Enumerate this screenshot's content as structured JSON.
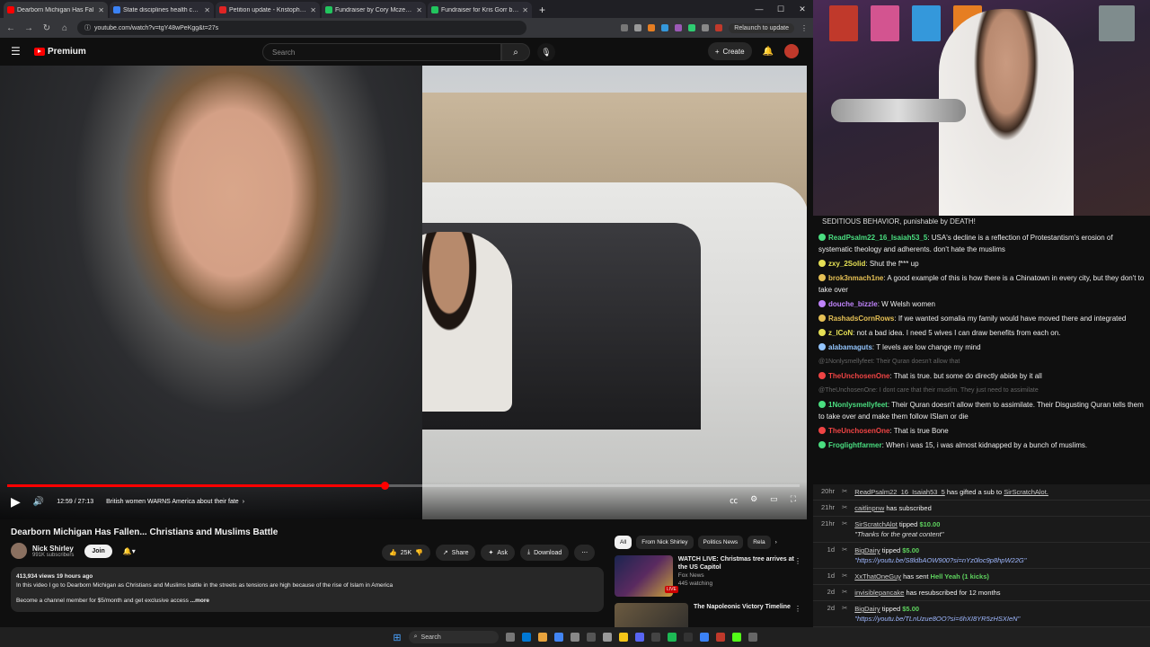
{
  "browser": {
    "tabs": [
      {
        "title": "Dearborn Michigan Has Fal",
        "color": "#ff0000",
        "active": true
      },
      {
        "title": "State disciplines health care pro",
        "color": "#3b82f6"
      },
      {
        "title": "Petition update - Kristopher's st",
        "color": "#e02424"
      },
      {
        "title": "Fundraiser by Cory Mczenna",
        "color": "#22c55e"
      },
      {
        "title": "Fundraiser for Kris Gorr by Kell",
        "color": "#22c55e"
      }
    ],
    "newtab": "+",
    "url": "youtube.com/watch?v=tgY48wPeKgg&t=27s",
    "relaunch": "Relaunch to update"
  },
  "yt": {
    "brand": "Premium",
    "search_placeholder": "Search",
    "create": "Create"
  },
  "video": {
    "time": "12:59 / 27:13",
    "chapter": "British women WARNS America about their fate",
    "progress": 0.476,
    "title": "Dearborn Michigan Has Fallen... Christians and Muslims Battle",
    "channel": "Nick Shirley",
    "subs": "991K subscribers",
    "join": "Join",
    "likes": "25K",
    "share": "Share",
    "ask": "Ask",
    "download": "Download",
    "desc_line1": "413,934 views  19 hours ago",
    "desc_line2": "In this video I go to Dearborn Michigan as Christians and Muslims battle in the streets as tensions are high because of the rise of Islam in America",
    "desc_line3": "Become a channel member for $5/month and get exclusive access",
    "more": "...more"
  },
  "recs": {
    "chips": [
      "All",
      "From Nick Shirley",
      "Politics News",
      "Rela"
    ],
    "items": [
      {
        "title": "WATCH LIVE: Christmas tree arrives at the US Capitol",
        "channel": "Fox News",
        "meta": "445 watching",
        "live": "LIVE"
      },
      {
        "title": "The Napoleonic Victory Timeline",
        "channel": "",
        "meta": ""
      }
    ]
  },
  "chat": {
    "top": "SEDITIOUS BEHAVIOR, punishable by DEATH!",
    "messages": [
      {
        "user": "ReadPsalm22_16_Isaiah53_5",
        "color": "#4ade80",
        "text": "USA's decline is a reflection of Protestantism's erosion of systematic theology and adherents. don't hate the muslims"
      },
      {
        "user": "zxy_2Solid",
        "color": "#e5e055",
        "text": "Shut the f*** up"
      },
      {
        "user": "brok3nmach1ne",
        "color": "#e5c055",
        "text": "A good example of this is how there is a Chinatown in every city, but they don't to take over"
      },
      {
        "user": "douche_bizzle",
        "color": "#c084fc",
        "text": "W Welsh women"
      },
      {
        "user": "RashadsCornRows",
        "color": "#e5c055",
        "text": "If we wanted somalia my family would have moved there and integrated"
      },
      {
        "user": "z_lCoN",
        "color": "#e5e055",
        "text": "not a bad idea. I need 5 wives I can draw benefits from each on."
      },
      {
        "user": "alabamaguts",
        "color": "#93c5fd",
        "text": "T levels are low change my mind"
      },
      {
        "reply": "@1Nonlysmellyfeet: Their Quran doesn't allow that"
      },
      {
        "user": "TheUnchosenOne",
        "color": "#ef4444",
        "text": "That is true. but some do directly abide by it all"
      },
      {
        "reply": "@TheUnchosenOne: I dont care that their muslim. They just need to assimilate"
      },
      {
        "user": "1Nonlysmellyfeet",
        "color": "#4ade80",
        "text": "Their Quran doesn't allow them to assimilate. Their Disgusting Quran tells them to take over and make them follow ISlam or die"
      },
      {
        "user": "TheUnchosenOne",
        "color": "#ef4444",
        "text": "That is true Bone"
      },
      {
        "user": "Froglightfarmer",
        "color": "#4ade80",
        "text": "When i was 15, i was almost kidnapped by a bunch of muslims."
      }
    ]
  },
  "events": [
    {
      "t": "20hr",
      "name": "ReadPsalm22_16_Isaiah53_5",
      "action": "has gifted a sub to",
      "target": "SirScratchAlot."
    },
    {
      "t": "21hr",
      "name": "caitlinpnw",
      "action": "has subscribed"
    },
    {
      "t": "21hr",
      "name": "SirScratchAlot",
      "action": "tipped",
      "amount": "$10.00",
      "quote": "\"Thanks for the great content\""
    },
    {
      "t": "1d",
      "name": "BigDairy",
      "action": "tipped",
      "amount": "$5.00",
      "link": "\"https://youtu.be/S8ldbAOW900?si=nYz0loc9p8hpW22G\""
    },
    {
      "t": "1d",
      "name": "XxThatOneGuy",
      "action": "has sent",
      "amount": "Hell Yeah (1 kicks)"
    },
    {
      "t": "2d",
      "name": "invisiblepancake",
      "action": "has resubscribed for 12 months"
    },
    {
      "t": "2d",
      "name": "BigDairy",
      "action": "tipped",
      "amount": "$5.00",
      "link": "\"https://youtu.be/TLnUzue8OO?si=6hXI8YR5zHSXIeN\""
    }
  ],
  "taskbar": {
    "search": "Search"
  }
}
